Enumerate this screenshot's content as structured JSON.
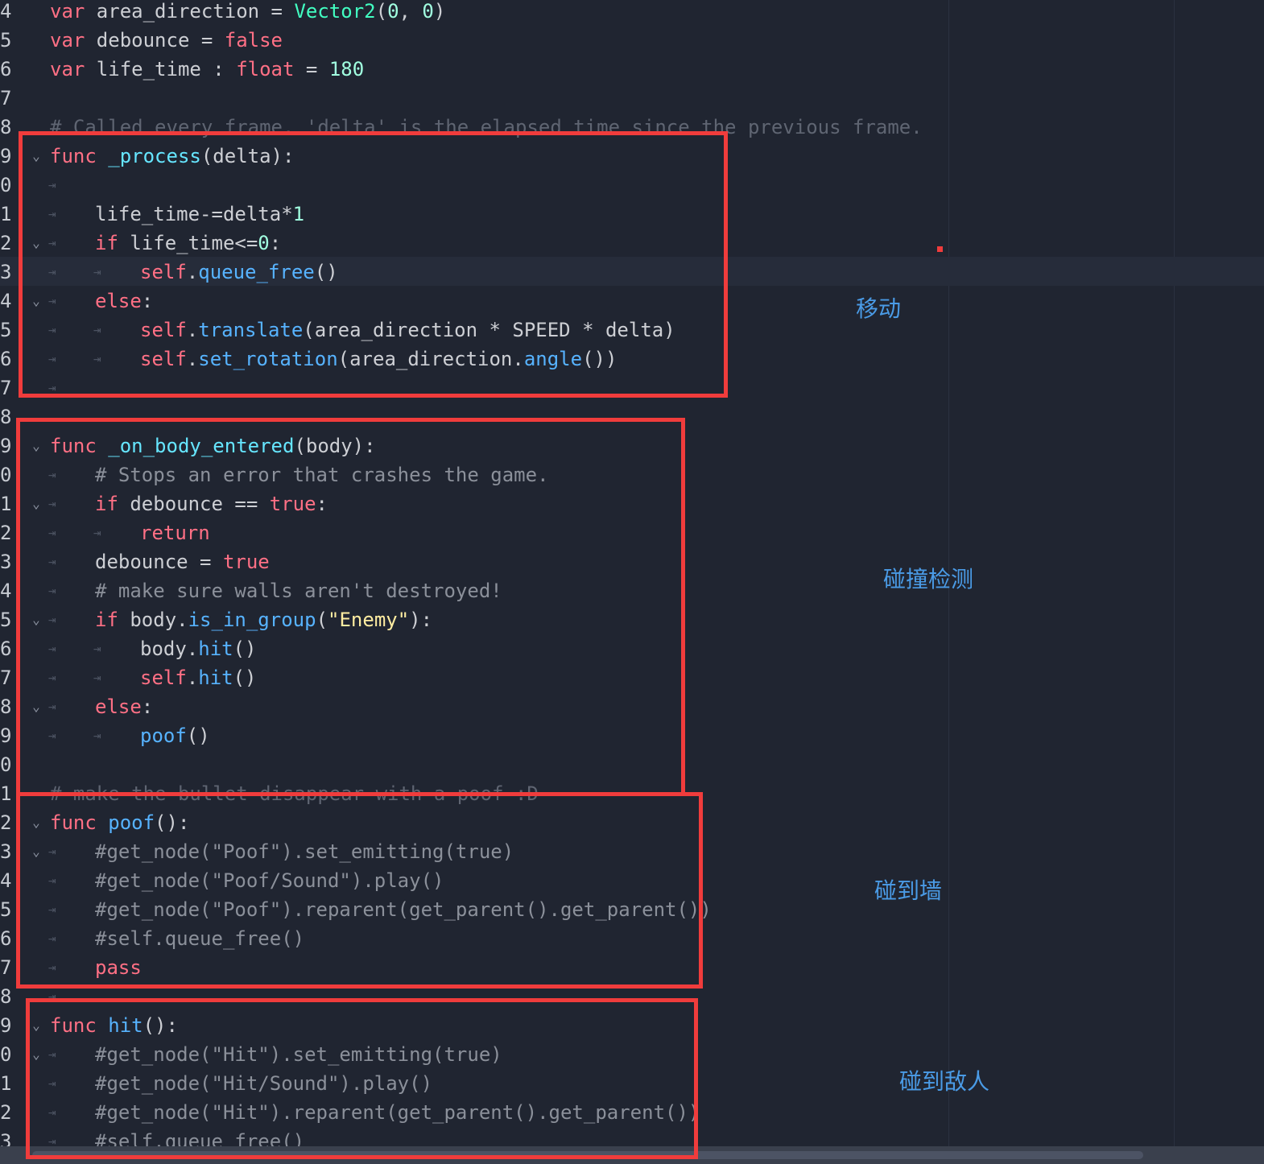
{
  "editor": {
    "lines": [
      {
        "n": "4",
        "fold": false,
        "tabs": 0,
        "tokens": [
          [
            "kw",
            "var"
          ],
          [
            "plain",
            " area_direction = "
          ],
          [
            "cls",
            "Vector2"
          ],
          [
            "plain",
            "("
          ],
          [
            "num",
            "0"
          ],
          [
            "plain",
            ", "
          ],
          [
            "num",
            "0"
          ],
          [
            "plain",
            ")"
          ]
        ]
      },
      {
        "n": "5",
        "fold": false,
        "tabs": 0,
        "tokens": [
          [
            "kw",
            "var"
          ],
          [
            "plain",
            " debounce = "
          ],
          [
            "kw",
            "false"
          ]
        ]
      },
      {
        "n": "6",
        "fold": false,
        "tabs": 0,
        "tokens": [
          [
            "kw",
            "var"
          ],
          [
            "plain",
            " life_time : "
          ],
          [
            "kw",
            "float"
          ],
          [
            "plain",
            " = "
          ],
          [
            "num",
            "180"
          ]
        ]
      },
      {
        "n": "7",
        "fold": false,
        "tabs": 0,
        "tokens": []
      },
      {
        "n": "8",
        "fold": false,
        "tabs": 0,
        "tokens": [
          [
            "cm-dim",
            "# Called every frame. 'delta' is the elapsed time since the previous frame."
          ]
        ]
      },
      {
        "n": "9",
        "fold": true,
        "tabs": 0,
        "tokens": [
          [
            "kw",
            "func"
          ],
          [
            "plain",
            " "
          ],
          [
            "fnd",
            "_process"
          ],
          [
            "plain",
            "(delta):"
          ]
        ]
      },
      {
        "n": "0",
        "fold": false,
        "tabs": 1,
        "tokens": []
      },
      {
        "n": "1",
        "fold": false,
        "tabs": 1,
        "tokens": [
          [
            "plain",
            "life_time-=delta*"
          ],
          [
            "num",
            "1"
          ]
        ]
      },
      {
        "n": "2",
        "fold": true,
        "tabs": 1,
        "tokens": [
          [
            "kw",
            "if"
          ],
          [
            "plain",
            " life_time<="
          ],
          [
            "num",
            "0"
          ],
          [
            "plain",
            ":"
          ]
        ]
      },
      {
        "n": "3",
        "fold": false,
        "tabs": 2,
        "tokens": [
          [
            "kw",
            "self"
          ],
          [
            "plain",
            "."
          ],
          [
            "fn",
            "queue_free"
          ],
          [
            "plain",
            "()"
          ]
        ]
      },
      {
        "n": "4",
        "fold": true,
        "tabs": 1,
        "tokens": [
          [
            "kw",
            "else"
          ],
          [
            "plain",
            ":"
          ]
        ]
      },
      {
        "n": "5",
        "fold": false,
        "tabs": 2,
        "tokens": [
          [
            "kw",
            "self"
          ],
          [
            "plain",
            "."
          ],
          [
            "fn",
            "translate"
          ],
          [
            "plain",
            "(area_direction * SPEED * delta)"
          ]
        ]
      },
      {
        "n": "6",
        "fold": false,
        "tabs": 2,
        "tokens": [
          [
            "kw",
            "self"
          ],
          [
            "plain",
            "."
          ],
          [
            "fn",
            "set_rotation"
          ],
          [
            "plain",
            "(area_direction."
          ],
          [
            "fn",
            "angle"
          ],
          [
            "plain",
            "())"
          ]
        ]
      },
      {
        "n": "7",
        "fold": false,
        "tabs": 1,
        "tokens": []
      },
      {
        "n": "8",
        "fold": false,
        "tabs": 0,
        "tokens": []
      },
      {
        "n": "9",
        "fold": true,
        "tabs": 0,
        "tokens": [
          [
            "kw",
            "func"
          ],
          [
            "plain",
            " "
          ],
          [
            "fnd",
            "_on_body_entered"
          ],
          [
            "plain",
            "(body):"
          ]
        ]
      },
      {
        "n": "0",
        "fold": false,
        "tabs": 1,
        "tokens": [
          [
            "cm",
            "# Stops an error that crashes the game."
          ]
        ]
      },
      {
        "n": "1",
        "fold": true,
        "tabs": 1,
        "tokens": [
          [
            "kw",
            "if"
          ],
          [
            "plain",
            " debounce == "
          ],
          [
            "kw",
            "true"
          ],
          [
            "plain",
            ":"
          ]
        ]
      },
      {
        "n": "2",
        "fold": false,
        "tabs": 2,
        "tokens": [
          [
            "kw",
            "return"
          ]
        ]
      },
      {
        "n": "3",
        "fold": false,
        "tabs": 1,
        "tokens": [
          [
            "plain",
            "debounce = "
          ],
          [
            "kw",
            "true"
          ]
        ]
      },
      {
        "n": "4",
        "fold": false,
        "tabs": 1,
        "tokens": [
          [
            "cm",
            "# make sure walls aren't destroyed!"
          ]
        ]
      },
      {
        "n": "5",
        "fold": true,
        "tabs": 1,
        "tokens": [
          [
            "kw",
            "if"
          ],
          [
            "plain",
            " body."
          ],
          [
            "fn",
            "is_in_group"
          ],
          [
            "plain",
            "("
          ],
          [
            "str",
            "\"Enemy\""
          ],
          [
            "plain",
            "):"
          ]
        ]
      },
      {
        "n": "6",
        "fold": false,
        "tabs": 2,
        "tokens": [
          [
            "plain",
            "body."
          ],
          [
            "fn",
            "hit"
          ],
          [
            "plain",
            "()"
          ]
        ]
      },
      {
        "n": "7",
        "fold": false,
        "tabs": 2,
        "tokens": [
          [
            "kw",
            "self"
          ],
          [
            "plain",
            "."
          ],
          [
            "fn",
            "hit"
          ],
          [
            "plain",
            "()"
          ]
        ]
      },
      {
        "n": "8",
        "fold": true,
        "tabs": 1,
        "tokens": [
          [
            "kw",
            "else"
          ],
          [
            "plain",
            ":"
          ]
        ]
      },
      {
        "n": "9",
        "fold": false,
        "tabs": 2,
        "tokens": [
          [
            "fn",
            "poof"
          ],
          [
            "plain",
            "()"
          ]
        ]
      },
      {
        "n": "0",
        "fold": false,
        "tabs": 0,
        "tokens": []
      },
      {
        "n": "1",
        "fold": false,
        "tabs": 0,
        "tokens": [
          [
            "cm-dim",
            "# make the bullet disappear with a poof :D"
          ]
        ]
      },
      {
        "n": "2",
        "fold": true,
        "tabs": 0,
        "tokens": [
          [
            "kw",
            "func"
          ],
          [
            "plain",
            " "
          ],
          [
            "fn",
            "poof"
          ],
          [
            "plain",
            "():"
          ]
        ]
      },
      {
        "n": "3",
        "fold": true,
        "tabs": 1,
        "tokens": [
          [
            "cm",
            "#get_node(\"Poof\").set_emitting(true)"
          ]
        ]
      },
      {
        "n": "4",
        "fold": false,
        "tabs": 1,
        "tokens": [
          [
            "cm",
            "#get_node(\"Poof/Sound\").play()"
          ]
        ]
      },
      {
        "n": "5",
        "fold": false,
        "tabs": 1,
        "tokens": [
          [
            "cm",
            "#get_node(\"Poof\").reparent(get_parent().get_parent())"
          ]
        ]
      },
      {
        "n": "6",
        "fold": false,
        "tabs": 1,
        "tokens": [
          [
            "cm",
            "#self.queue_free()"
          ]
        ]
      },
      {
        "n": "7",
        "fold": false,
        "tabs": 1,
        "tokens": [
          [
            "kw",
            "pass"
          ]
        ]
      },
      {
        "n": "8",
        "fold": false,
        "tabs": 1,
        "tokens": []
      },
      {
        "n": "9",
        "fold": true,
        "tabs": 0,
        "tokens": [
          [
            "kw",
            "func"
          ],
          [
            "plain",
            " "
          ],
          [
            "fn",
            "hit"
          ],
          [
            "plain",
            "():"
          ]
        ]
      },
      {
        "n": "0",
        "fold": true,
        "tabs": 1,
        "tokens": [
          [
            "cm",
            "#get_node(\"Hit\").set_emitting(true)"
          ]
        ]
      },
      {
        "n": "1",
        "fold": false,
        "tabs": 1,
        "tokens": [
          [
            "cm",
            "#get_node(\"Hit/Sound\").play()"
          ]
        ]
      },
      {
        "n": "2",
        "fold": false,
        "tabs": 1,
        "tokens": [
          [
            "cm",
            "#get_node(\"Hit\").reparent(get_parent().get_parent())"
          ]
        ]
      },
      {
        "n": "3",
        "fold": false,
        "tabs": 1,
        "tokens": [
          [
            "cm",
            "#self.queue_free()"
          ]
        ]
      }
    ]
  },
  "annotations": {
    "move": "移动",
    "collision": "碰撞检测",
    "hit_wall": "碰到墙",
    "hit_enemy": "碰到敌人"
  },
  "colors": {
    "background": "#202531",
    "annotation_box": "#f03c3c",
    "annotation_text": "#4a9be6",
    "keyword": "#ff7085",
    "function": "#57b3ff",
    "number": "#a1ffe0",
    "string": "#ffeda1",
    "comment": "#8b909a"
  }
}
